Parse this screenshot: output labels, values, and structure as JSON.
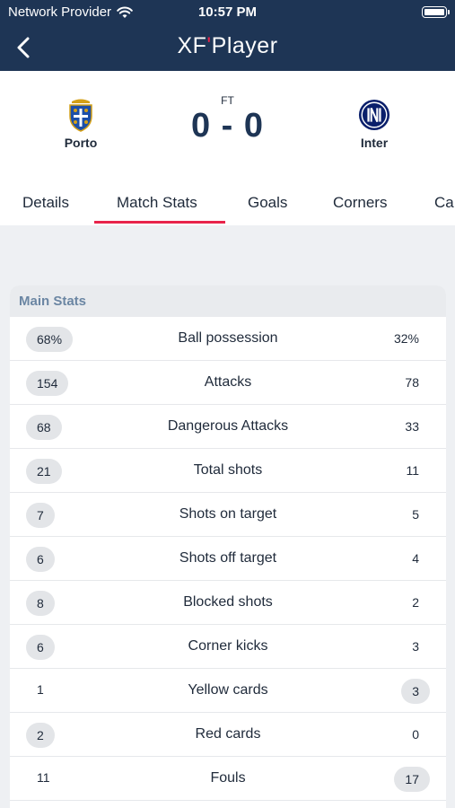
{
  "status_bar": {
    "carrier": "Network Provider",
    "time": "10:57 PM"
  },
  "nav": {
    "title_prefix": "XF",
    "title_suffix": "Player"
  },
  "match": {
    "status": "FT",
    "score": "0 - 0",
    "home_team": "Porto",
    "away_team": "Inter"
  },
  "tabs": [
    "Details",
    "Match Stats",
    "Goals",
    "Corners",
    "Ca"
  ],
  "active_tab": "Match Stats",
  "stats": {
    "section_title": "Main Stats",
    "rows": [
      {
        "label": "Ball possession",
        "home": "68%",
        "away": "32%",
        "highlight": "home"
      },
      {
        "label": "Attacks",
        "home": "154",
        "away": "78",
        "highlight": "home"
      },
      {
        "label": "Dangerous Attacks",
        "home": "68",
        "away": "33",
        "highlight": "home"
      },
      {
        "label": "Total shots",
        "home": "21",
        "away": "11",
        "highlight": "home"
      },
      {
        "label": "Shots on target",
        "home": "7",
        "away": "5",
        "highlight": "home"
      },
      {
        "label": "Shots off target",
        "home": "6",
        "away": "4",
        "highlight": "home"
      },
      {
        "label": "Blocked shots",
        "home": "8",
        "away": "2",
        "highlight": "home"
      },
      {
        "label": "Corner kicks",
        "home": "6",
        "away": "3",
        "highlight": "home"
      },
      {
        "label": "Yellow cards",
        "home": "1",
        "away": "3",
        "highlight": "away"
      },
      {
        "label": "Red cards",
        "home": "2",
        "away": "0",
        "highlight": "home"
      },
      {
        "label": "Fouls",
        "home": "11",
        "away": "17",
        "highlight": "away"
      }
    ]
  },
  "colors": {
    "navy": "#1e3555",
    "accent": "#e8234a",
    "pill": "#e3e5e8",
    "section_text": "#6b86a3"
  },
  "icons": [
    "wifi-icon",
    "battery-icon",
    "back-arrow-icon",
    "porto-crest-icon",
    "inter-crest-icon"
  ]
}
